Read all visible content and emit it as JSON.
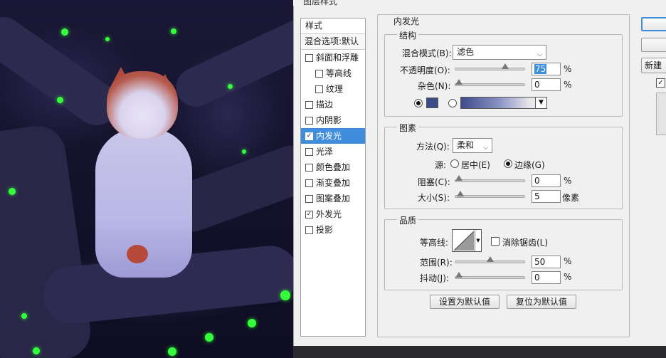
{
  "dialog": {
    "title": "图层样式"
  },
  "styles_panel": {
    "header": "样式",
    "blend_options": "混合选项:默认",
    "items": [
      {
        "label": "斜面和浮雕",
        "checked": false,
        "indent": false,
        "selected": false
      },
      {
        "label": "等高线",
        "checked": false,
        "indent": true,
        "selected": false
      },
      {
        "label": "纹理",
        "checked": false,
        "indent": true,
        "selected": false
      },
      {
        "label": "描边",
        "checked": false,
        "indent": false,
        "selected": false
      },
      {
        "label": "内阴影",
        "checked": false,
        "indent": false,
        "selected": false
      },
      {
        "label": "内发光",
        "checked": true,
        "indent": false,
        "selected": true
      },
      {
        "label": "光泽",
        "checked": false,
        "indent": false,
        "selected": false
      },
      {
        "label": "颜色叠加",
        "checked": false,
        "indent": false,
        "selected": false
      },
      {
        "label": "渐变叠加",
        "checked": false,
        "indent": false,
        "selected": false
      },
      {
        "label": "图案叠加",
        "checked": false,
        "indent": false,
        "selected": false
      },
      {
        "label": "外发光",
        "checked": true,
        "indent": false,
        "selected": false
      },
      {
        "label": "投影",
        "checked": false,
        "indent": false,
        "selected": false
      }
    ]
  },
  "inner_glow": {
    "title": "内发光",
    "structure": {
      "title": "结构",
      "blend_mode_label": "混合模式(B):",
      "blend_mode_value": "滤色",
      "opacity_label": "不透明度(O):",
      "opacity_value": "75",
      "opacity_fraction": 0.75,
      "noise_label": "杂色(N):",
      "noise_value": "0",
      "noise_fraction": 0,
      "percent": "%",
      "glow_color": "#3e4b8a"
    },
    "elements": {
      "title": "图素",
      "technique_label": "方法(Q):",
      "technique_value": "柔和",
      "source_label": "源:",
      "source_center_label": "居中(E)",
      "source_edge_label": "边缘(G)",
      "choke_label": "阻塞(C):",
      "choke_value": "0",
      "choke_fraction": 0,
      "size_label": "大小(S):",
      "size_value": "5",
      "size_fraction": 0.02,
      "percent": "%",
      "pixels_unit": "像素"
    },
    "quality": {
      "title": "品质",
      "contour_label": "等高线:",
      "anti_alias_label": "消除锯齿(L)",
      "range_label": "范围(R):",
      "range_value": "50",
      "range_fraction": 0.5,
      "jitter_label": "抖动(J):",
      "jitter_value": "0",
      "jitter_fraction": 0,
      "percent": "%"
    },
    "make_default_label": "设置为默认值",
    "reset_default_label": "复位为默认值"
  },
  "right_buttons": {
    "new_style_label": "新建"
  },
  "colors": {
    "selection": "#3e8edc",
    "glow": "#36ff3c"
  }
}
